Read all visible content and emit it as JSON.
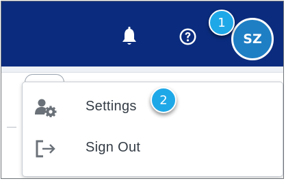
{
  "header": {
    "avatar_initials": "SZ",
    "notifications_icon": "bell-icon",
    "help_icon": "question-circle-icon"
  },
  "callouts": [
    "1",
    "2"
  ],
  "user_menu": {
    "items": [
      {
        "label": "Settings",
        "icon": "user-settings-icon"
      },
      {
        "label": "Sign Out",
        "icon": "sign-out-icon"
      }
    ]
  },
  "colors": {
    "header_bg": "#0b2c7e",
    "avatar_bg": "#1f7fc4",
    "callout_bg": "#1fa8e8",
    "menu_text": "#333b44",
    "icon_gray": "#6b7178"
  }
}
